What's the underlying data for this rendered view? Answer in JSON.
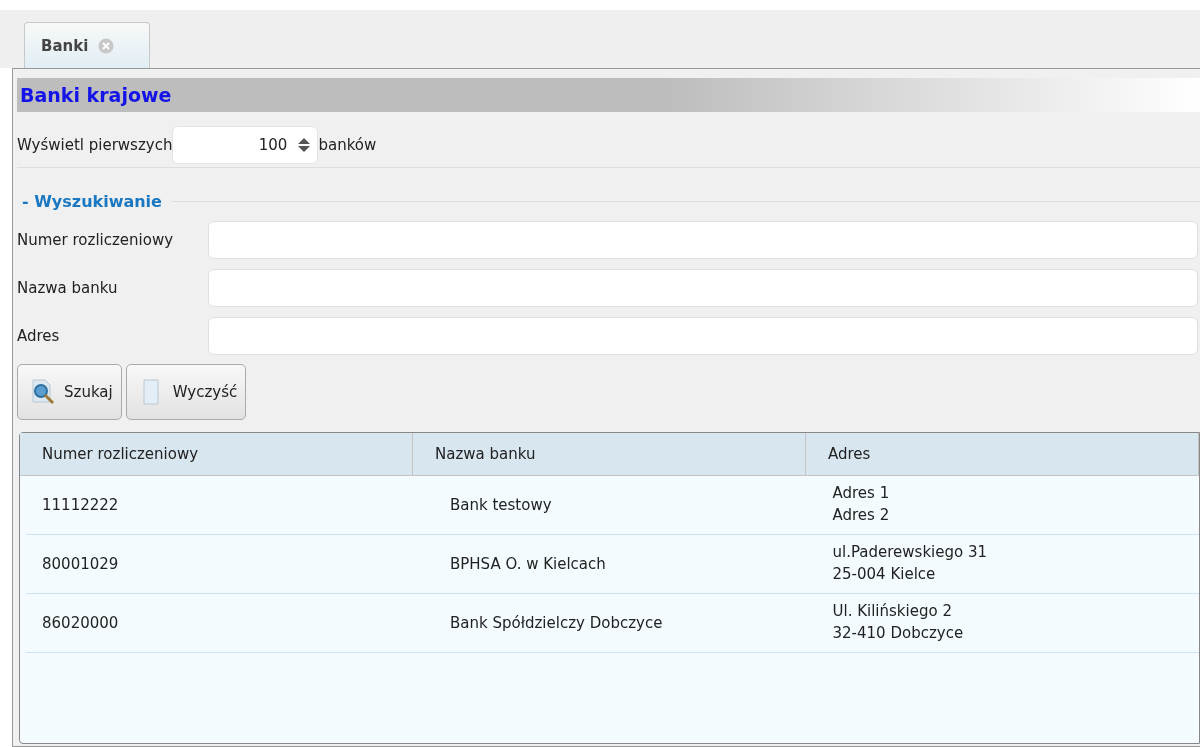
{
  "tabs": [
    {
      "label": "Banki",
      "selected": true
    }
  ],
  "panel": {
    "title": "Banki krajowe"
  },
  "limit": {
    "label_before": "Wyświetl pierwszych",
    "value": "100",
    "label_after": "banków"
  },
  "search": {
    "title": "- Wyszukiwanie",
    "fields": [
      {
        "label": "Numer rozliczeniowy"
      },
      {
        "label": "Nazwa banku"
      },
      {
        "label": "Adres"
      }
    ],
    "buttons": [
      {
        "label": "Szukaj",
        "kind": "search"
      },
      {
        "label": "Wyczyść",
        "kind": "clear"
      }
    ]
  },
  "table": {
    "columns": [
      "Numer rozliczeniowy",
      "Nazwa banku",
      "Adres"
    ],
    "rows": [
      {
        "number": "11112222",
        "name": "Bank testowy",
        "address": [
          "Adres 1",
          "Adres 2"
        ]
      },
      {
        "number": "80001029",
        "name": "BPHSA O. w Kielcach",
        "address": [
          "ul.Paderewskiego 31",
          "25-004 Kielce"
        ]
      },
      {
        "number": "86020000",
        "name": "Bank Spółdzielczy Dobczyce",
        "address": [
          "Ul. Kilińskiego 2",
          "32-410 Dobczyce"
        ]
      }
    ]
  }
}
